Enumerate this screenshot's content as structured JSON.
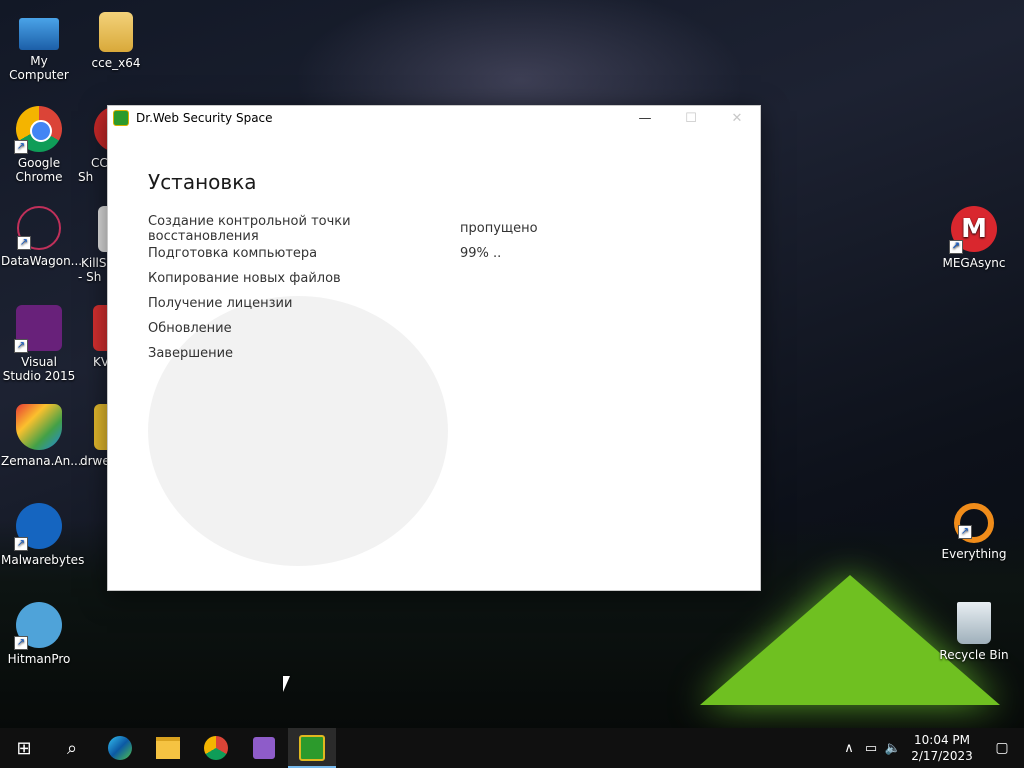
{
  "desktop": {
    "icons_left": [
      {
        "label": "My Computer",
        "icon": "computer-icon"
      },
      {
        "label": "Google Chrome",
        "icon": "chrome-icon"
      },
      {
        "label": "DataWagon...",
        "icon": "datawagon-icon"
      },
      {
        "label": "Visual Studio 2015",
        "icon": "visual-studio-icon"
      },
      {
        "label": "Zemana.An...",
        "icon": "zemana-icon"
      },
      {
        "label": "Malwarebytes",
        "icon": "malwarebytes-icon"
      },
      {
        "label": "HitmanPro",
        "icon": "hitmanpro-icon"
      }
    ],
    "icons_col2": [
      {
        "label": "cce_x64",
        "icon": "folder-icon"
      },
      {
        "label": "CC Sh",
        "icon": "ccleaner-icon"
      },
      {
        "label": "KillSw - Sh",
        "icon": "killswitch-icon"
      },
      {
        "label": "KV",
        "icon": "kv-icon"
      },
      {
        "label": "drwe",
        "icon": "drweb-icon"
      }
    ],
    "icons_right": [
      {
        "label": "MEGAsync",
        "icon": "mega-icon"
      },
      {
        "label": "Everything",
        "icon": "everything-icon"
      },
      {
        "label": "Recycle Bin",
        "icon": "recycle-bin-icon"
      }
    ]
  },
  "window": {
    "title": "Dr.Web Security Space",
    "minimize": "—",
    "maximize": "☐",
    "close": "✕",
    "heading": "Установка",
    "steps": [
      {
        "label": "Создание контрольной точки восстановления",
        "status": "пропущено"
      },
      {
        "label": "Подготовка компьютера",
        "status": "99%  .."
      },
      {
        "label": "Копирование новых файлов",
        "status": ""
      },
      {
        "label": "Получение лицензии",
        "status": ""
      },
      {
        "label": "Обновление",
        "status": ""
      },
      {
        "label": "Завершение",
        "status": ""
      }
    ]
  },
  "taskbar": {
    "start": "⊞",
    "search": "⌕",
    "apps": [
      "edge-icon",
      "file-explorer-icon",
      "chrome-icon",
      "visual-studio-icon",
      "drweb-icon"
    ],
    "tray": {
      "chevron": "∧",
      "network": "▭",
      "volume": "🔈"
    },
    "time": "10:04 PM",
    "date": "2/17/2023",
    "notifications": "▢"
  }
}
